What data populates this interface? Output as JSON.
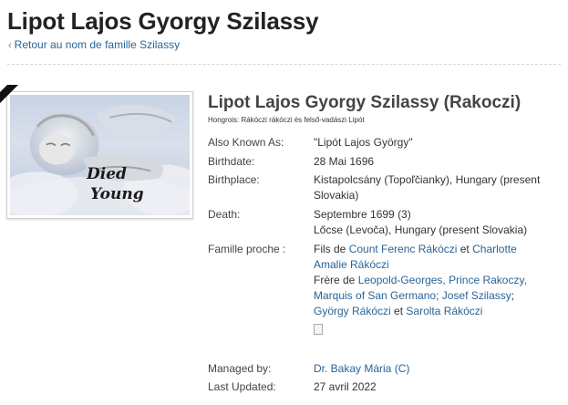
{
  "header": {
    "title": "Lipot Lajos Gyorgy Szilassy",
    "back_link": "Retour au nom de famille Szilassy"
  },
  "photo": {
    "line1": "Died",
    "line2": "Young"
  },
  "profile": {
    "name": "Lipot Lajos Gyorgy Szilassy (Rakoczi)",
    "native": "Hongrois: Rákóczi rákóczi és felső-vadászi Lipót"
  },
  "facts": {
    "aka_label": "Also Known As:",
    "aka_value": "\"Lipót Lajos György\"",
    "birthdate_label": "Birthdate:",
    "birthdate_value": "28 Mai 1696",
    "birthplace_label": "Birthplace:",
    "birthplace_value": "Kistapolcsány (Topoľčianky), Hungary (present Slovakia)",
    "death_label": "Death:",
    "death_date": "Septembre 1699 (3)",
    "death_place": "Lőcse (Levoča), Hungary (present Slovakia)",
    "family_label": "Famille proche :",
    "son_of": "Fils de",
    "father": "Count Ferenc Rákóczi",
    "and1": "et",
    "mother": "Charlotte Amalie Rákóczi",
    "brother_of": "Frère de",
    "sib1": "Leopold-Georges, Prince Rakoczy, Marquis of San Germano",
    "sep1": ";",
    "sib2": "Josef Szilassy",
    "sep2": ";",
    "sib3": "György Rákóczi",
    "and2": "et",
    "sib4": "Sarolta Rákóczi",
    "managed_label": "Managed by:",
    "managed_value": "Dr. Bakay Mária (C)",
    "updated_label": "Last Updated:",
    "updated_value": "27 avril 2022"
  }
}
